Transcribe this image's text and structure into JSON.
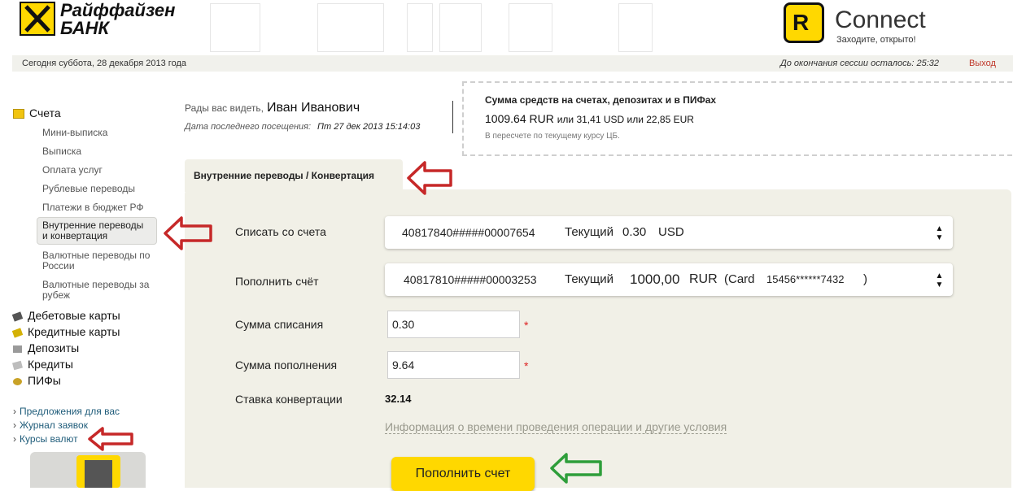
{
  "header": {
    "bank_name_line1": "Райффайзен",
    "bank_name_line2": "БАНК",
    "connect_mark": "R",
    "connect_title": "Connect",
    "connect_tagline": "Заходите, открыто!"
  },
  "status_bar": {
    "date": "Сегодня суббота, 28 декабря 2013 года",
    "session": "До окончания сессии осталось: 25:32",
    "logout": "Выход"
  },
  "sidebar": {
    "main_section": "Счета",
    "items": [
      "Мини-выписка",
      "Выписка",
      "Оплата услуг",
      "Рублевые переводы",
      "Платежи в бюджет РФ",
      "Внутренние переводы и конвертация",
      "Валютные переводы по России",
      "Валютные переводы за рубеж"
    ],
    "sections": [
      "Дебетовые карты",
      "Кредитные карты",
      "Депозиты",
      "Кредиты",
      "ПИФы"
    ],
    "links": [
      "Предложения для вас",
      "Журнал заявок",
      "Курсы валют"
    ]
  },
  "greeting": {
    "prefix": "Рады вас видеть,",
    "name": "Иван Иванович",
    "last_visit_label": "Дата последнего посещения:",
    "last_visit_value": "Пт 27 дек 2013  15:14:03"
  },
  "balance": {
    "title": "Сумма средств на счетах, депозитах и в ПИФах",
    "amount": "1009.64 RUR",
    "amount_other": "или 31,41 USD или 22,85 EUR",
    "note": "В пересчете по текущему курсу ЦБ."
  },
  "tab": {
    "label": "Внутренние переводы / Конвертация"
  },
  "form": {
    "from_label": "Списать со счета",
    "from_account": "40817840#####00007654",
    "from_type": "Текущий",
    "from_balance": "0.30",
    "from_currency": "USD",
    "to_label": "Пополнить счёт",
    "to_account": "40817810#####00003253",
    "to_type": "Текущий",
    "to_balance": "1000,00",
    "to_currency": "RUR",
    "to_card_prefix": "(Card",
    "to_card_number": "15456******7432",
    "to_card_suffix": ")",
    "debit_label": "Сумма списания",
    "debit_value": "0.30",
    "credit_label": "Сумма пополнения",
    "credit_value": "9.64",
    "required_mark": "*",
    "rate_label": "Ставка конвертации",
    "rate_value": "32.14",
    "info_link": "Информация о времени проведения операции и другие условия",
    "submit_label": "Пополнить счет",
    "select_arrows": "▲▼"
  },
  "colors": {
    "brand_yellow": "#ffd800",
    "panel_bg": "#f1f0e7",
    "annotation_red": "#c62828",
    "annotation_green": "#2e9e3a",
    "logout_red": "#c0392b"
  },
  "icons": {
    "accounts": "folder-icon",
    "debit_cards": "debit-card-icon",
    "credit_cards": "credit-card-icon",
    "deposits": "deposit-icon",
    "credits": "credit-icon",
    "funds": "coins-icon"
  }
}
